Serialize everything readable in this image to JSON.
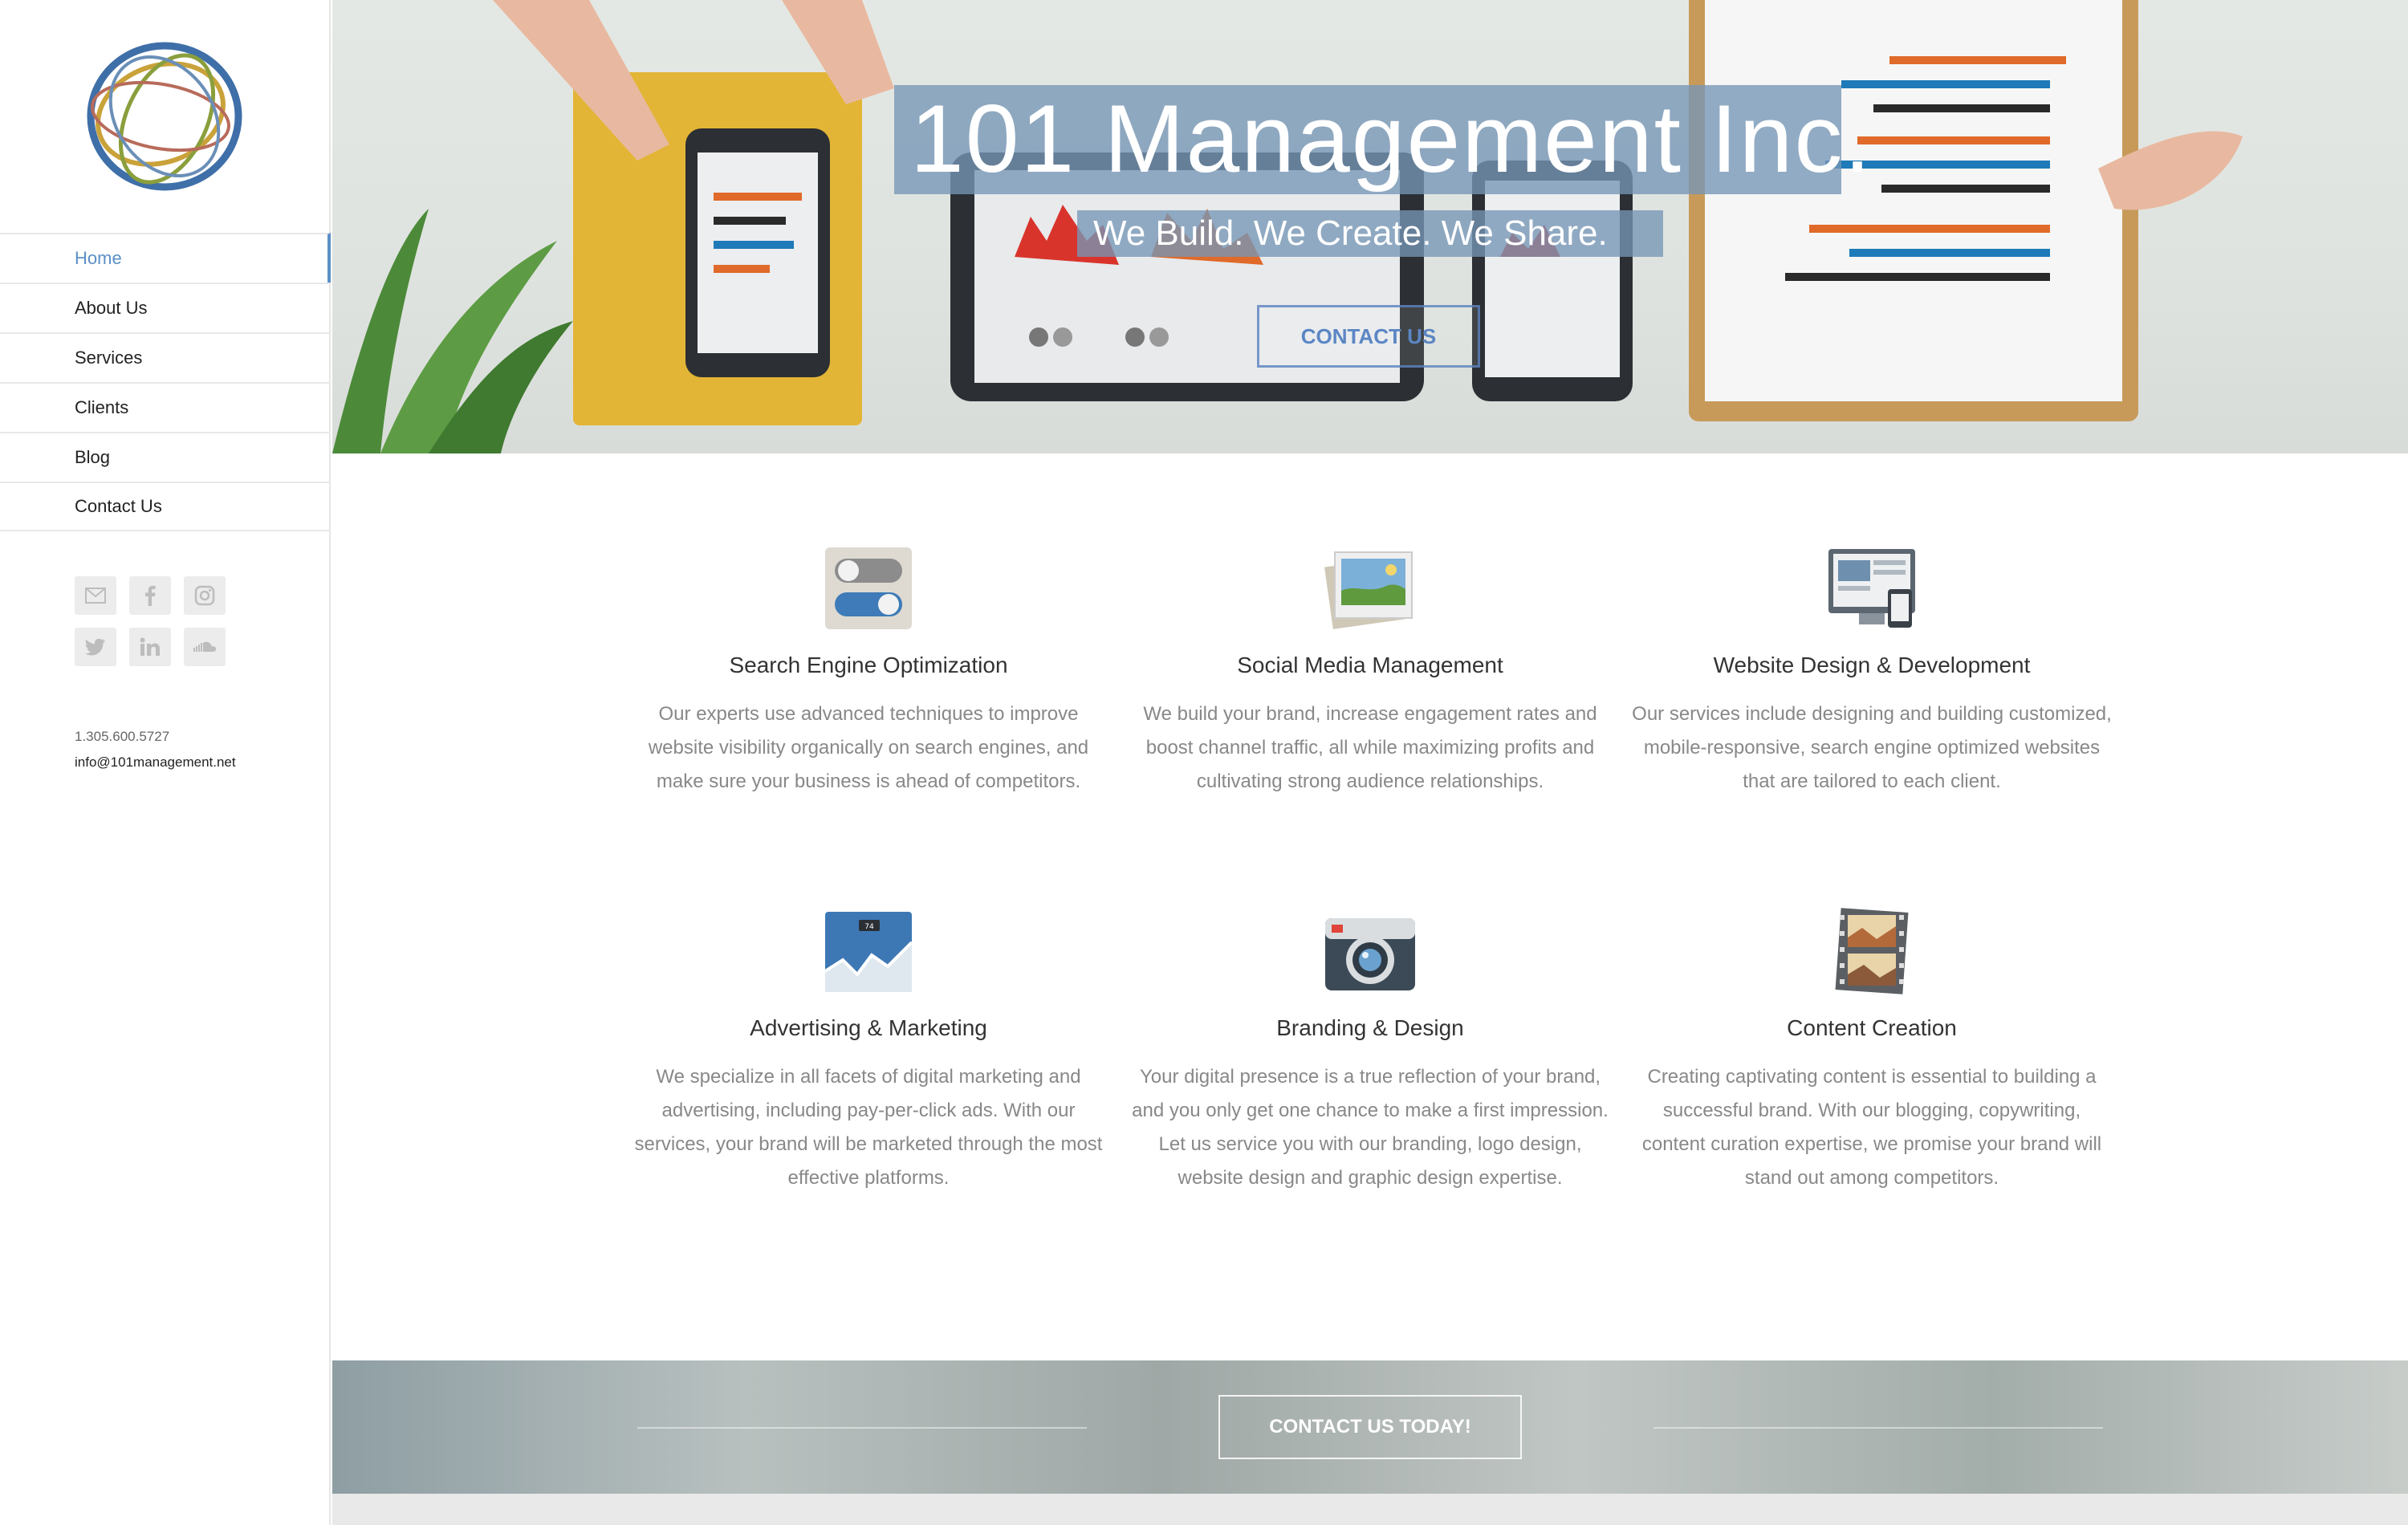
{
  "sidebar": {
    "nav": [
      {
        "label": "Home",
        "active": true
      },
      {
        "label": "About Us"
      },
      {
        "label": "Services"
      },
      {
        "label": "Clients"
      },
      {
        "label": "Blog"
      },
      {
        "label": "Contact Us"
      }
    ],
    "social_icons": [
      "mail-icon",
      "facebook-icon",
      "instagram-icon",
      "twitter-icon",
      "linkedin-icon",
      "soundcloud-icon"
    ],
    "phone": "1.305.600.5727",
    "email": "info@101management.net"
  },
  "hero": {
    "title": "101 Management Inc.",
    "subtitle": "We Build. We Create. We Share.",
    "button": "CONTACT US"
  },
  "services": [
    {
      "title": "Search Engine Optimization",
      "text": "Our experts use advanced techniques to improve website visibility organically on search engines, and make sure your business is ahead of competitors.",
      "icon": "toggle-switches-icon"
    },
    {
      "title": "Social Media Management",
      "text": "We build your brand, increase engagement rates and boost channel traffic, all while maximizing profits and cultivating strong audience relationships.",
      "icon": "photos-icon"
    },
    {
      "title": "Website Design & Development",
      "text": "Our services include designing and building customized, mobile-responsive, search engine optimized websites that are tailored to each client.",
      "icon": "devices-icon"
    },
    {
      "title": "Advertising & Marketing",
      "text": "We specialize in all facets of digital marketing and advertising, including pay-per-click ads. With our services, your brand will be marketed through the most effective platforms.",
      "icon": "line-chart-icon"
    },
    {
      "title": "Branding & Design",
      "text": "Your digital presence is a true reflection of your brand, and you only get one chance to make a first impression. Let us service you with our branding, logo design, website design and graphic design expertise.",
      "icon": "camera-icon"
    },
    {
      "title": "Content Creation",
      "text": "Creating captivating content is essential to building a successful brand. With our blogging, copywriting, content curation expertise, we promise your brand will stand out among competitors.",
      "icon": "film-strip-icon"
    }
  ],
  "cta": {
    "button": "CONTACT US TODAY!"
  },
  "colors": {
    "accent": "#5b8fc7",
    "title_bg": "#7696b6"
  }
}
